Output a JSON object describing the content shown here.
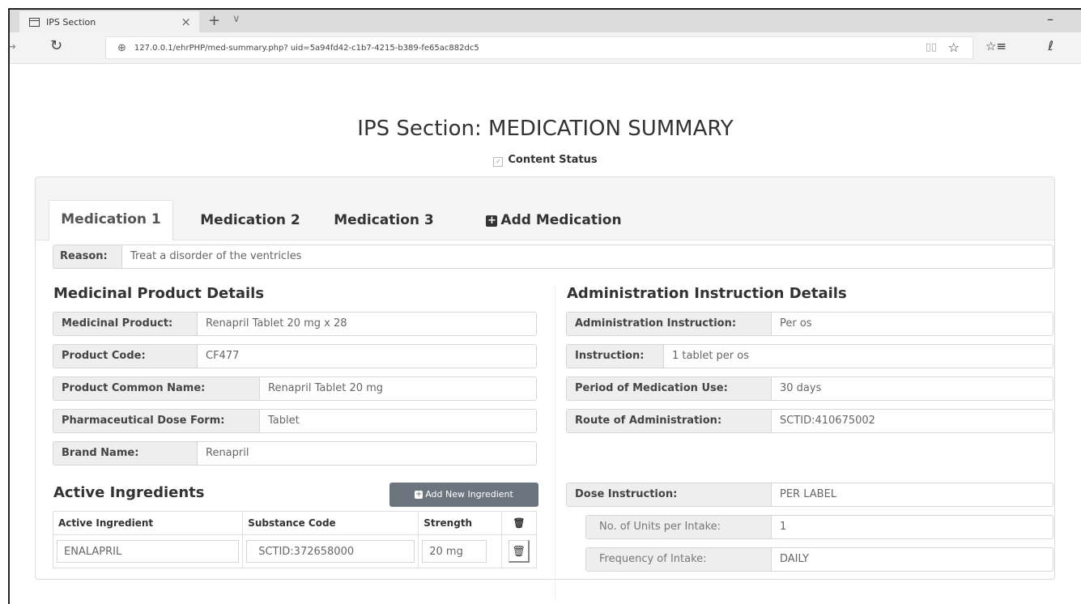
{
  "browser": {
    "tab_title": "IPS Section",
    "tab_close": "×",
    "new_tab": "+",
    "tab_menu": "∨",
    "minimize": "–",
    "url": "127.0.0.1/ehrPHP/med-summary.php? uid=5a94fd42-c1b7-4215-b389-fe65ac882dc5",
    "icons": [
      "tab-page-icon",
      "back-arrow-icon",
      "refresh-icon",
      "globe-icon",
      "reading-view-icon",
      "star-icon",
      "favorites-icon",
      "pen-icon"
    ]
  },
  "page": {
    "title": "IPS Section: MEDICATION SUMMARY",
    "content_status": "Content Status"
  },
  "tabs": [
    {
      "label": "Medication 1",
      "active": true
    },
    {
      "label": "Medication 2",
      "active": false
    },
    {
      "label": "Medication 3",
      "active": false
    },
    {
      "label": "Add Medication",
      "active": false
    }
  ],
  "reason": {
    "label": "Reason:",
    "value": "Treat a disorder of the ventricles"
  },
  "medicinal_product": {
    "heading": "Medicinal Product Details",
    "fields": [
      {
        "label": "Medicinal Product:",
        "value": "Renapril Tablet 20 mg x 28"
      },
      {
        "label": "Product Code:",
        "value": "CF477"
      },
      {
        "label": "Product Common Name:",
        "value": "Renapril Tablet 20 mg"
      },
      {
        "label": "Pharmaceutical Dose Form:",
        "value": "Tablet"
      },
      {
        "label": "Brand Name:",
        "value": "Renapril"
      }
    ]
  },
  "administration": {
    "heading": "Administration Instruction Details",
    "fields": [
      {
        "label": "Administration Instruction:",
        "value": "Per os"
      },
      {
        "label": "Instruction:",
        "value": "1 tablet per os"
      },
      {
        "label": "Period of Medication Use:",
        "value": "30 days"
      },
      {
        "label": "Route of Administration:",
        "value": "SCTID:410675002"
      }
    ],
    "dose": {
      "label": "Dose Instruction:",
      "value": "PER LABEL"
    },
    "dose_sub": [
      {
        "label": "No. of Units per Intake:",
        "value": "1"
      },
      {
        "label": "Frequency of Intake:",
        "value": "DAILY"
      }
    ]
  },
  "ingredients": {
    "heading": "Active Ingredients",
    "add_button": "Add New Ingredient",
    "columns": [
      "Active Ingredient",
      "Substance Code",
      "Strength"
    ],
    "rows": [
      {
        "ingredient": "ENALAPRIL",
        "code": "SCTID:372658000",
        "strength": "20 mg"
      }
    ]
  },
  "colors": {
    "accent_button": "#6c757d",
    "label_bg": "#eeeeee",
    "border": "#d6d6d6"
  }
}
